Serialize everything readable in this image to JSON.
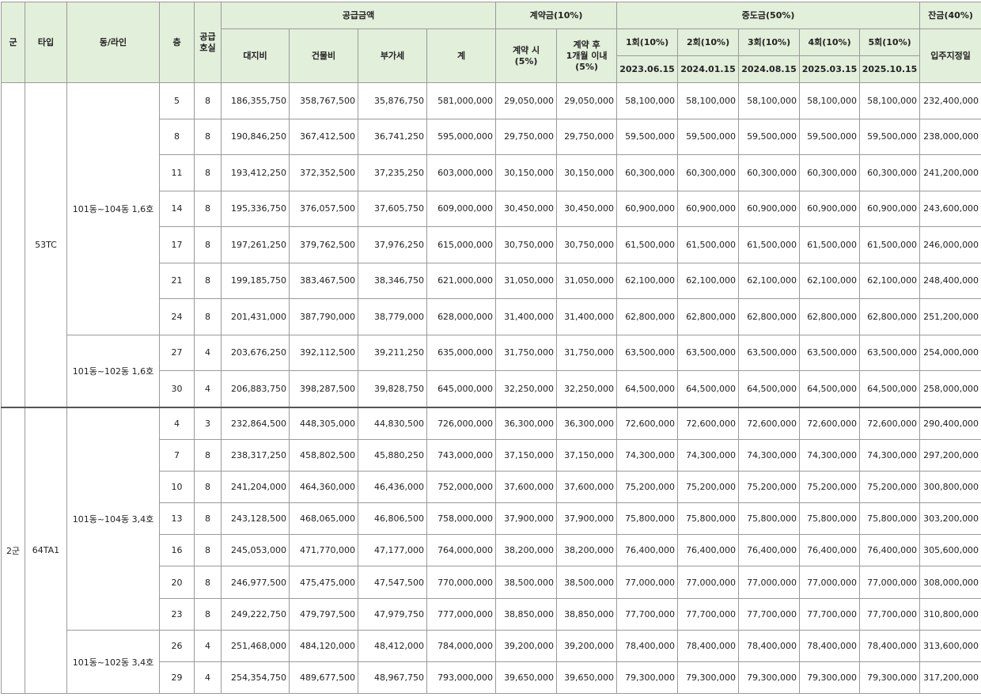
{
  "headers": {
    "gun": "군",
    "type": "타입",
    "dong_line": "동/라인",
    "floor": "층",
    "units_line1": "공급",
    "units_line2": "호실",
    "supply_amount": "공급금액",
    "land": "대지비",
    "building": "건물비",
    "vat": "부가세",
    "total": "계",
    "contract": "계약금(10%)",
    "contract_at_line1": "계약 시",
    "contract_at_line2": "(5%)",
    "contract_after_line1": "계약 후",
    "contract_after_line2": "1개월 이내",
    "contract_after_line3": "(5%)",
    "interim": "중도금(50%)",
    "interim_labels": [
      "1회(10%)",
      "2회(10%)",
      "3회(10%)",
      "4회(10%)",
      "5회(10%)"
    ],
    "interim_dates": [
      "2023.06.15",
      "2024.01.15",
      "2024.08.15",
      "2025.03.15",
      "2025.10.15"
    ],
    "balance": "잔금(40%)",
    "move_in": "입주지정일"
  },
  "groups": [
    {
      "gun": "",
      "type": "53TC",
      "blocks": [
        {
          "dong": "101동~104동 1,6호",
          "rows": [
            [
              "5",
              "8",
              "186,355,750",
              "358,767,500",
              "35,876,750",
              "581,000,000",
              "29,050,000",
              "29,050,000",
              "58,100,000",
              "58,100,000",
              "58,100,000",
              "58,100,000",
              "58,100,000",
              "232,400,000"
            ],
            [
              "8",
              "8",
              "190,846,250",
              "367,412,500",
              "36,741,250",
              "595,000,000",
              "29,750,000",
              "29,750,000",
              "59,500,000",
              "59,500,000",
              "59,500,000",
              "59,500,000",
              "59,500,000",
              "238,000,000"
            ],
            [
              "11",
              "8",
              "193,412,250",
              "372,352,500",
              "37,235,250",
              "603,000,000",
              "30,150,000",
              "30,150,000",
              "60,300,000",
              "60,300,000",
              "60,300,000",
              "60,300,000",
              "60,300,000",
              "241,200,000"
            ],
            [
              "14",
              "8",
              "195,336,750",
              "376,057,500",
              "37,605,750",
              "609,000,000",
              "30,450,000",
              "30,450,000",
              "60,900,000",
              "60,900,000",
              "60,900,000",
              "60,900,000",
              "60,900,000",
              "243,600,000"
            ],
            [
              "17",
              "8",
              "197,261,250",
              "379,762,500",
              "37,976,250",
              "615,000,000",
              "30,750,000",
              "30,750,000",
              "61,500,000",
              "61,500,000",
              "61,500,000",
              "61,500,000",
              "61,500,000",
              "246,000,000"
            ],
            [
              "21",
              "8",
              "199,185,750",
              "383,467,500",
              "38,346,750",
              "621,000,000",
              "31,050,000",
              "31,050,000",
              "62,100,000",
              "62,100,000",
              "62,100,000",
              "62,100,000",
              "62,100,000",
              "248,400,000"
            ],
            [
              "24",
              "8",
              "201,431,000",
              "387,790,000",
              "38,779,000",
              "628,000,000",
              "31,400,000",
              "31,400,000",
              "62,800,000",
              "62,800,000",
              "62,800,000",
              "62,800,000",
              "62,800,000",
              "251,200,000"
            ]
          ]
        },
        {
          "dong": "101동~102동 1,6호",
          "rows": [
            [
              "27",
              "4",
              "203,676,250",
              "392,112,500",
              "39,211,250",
              "635,000,000",
              "31,750,000",
              "31,750,000",
              "63,500,000",
              "63,500,000",
              "63,500,000",
              "63,500,000",
              "63,500,000",
              "254,000,000"
            ],
            [
              "30",
              "4",
              "206,883,750",
              "398,287,500",
              "39,828,750",
              "645,000,000",
              "32,250,000",
              "32,250,000",
              "64,500,000",
              "64,500,000",
              "64,500,000",
              "64,500,000",
              "64,500,000",
              "258,000,000"
            ]
          ]
        }
      ]
    },
    {
      "gun": "2군",
      "type": "64TA1",
      "blocks": [
        {
          "dong": "101동~104동 3,4호",
          "rows": [
            [
              "4",
              "3",
              "232,864,500",
              "448,305,000",
              "44,830,500",
              "726,000,000",
              "36,300,000",
              "36,300,000",
              "72,600,000",
              "72,600,000",
              "72,600,000",
              "72,600,000",
              "72,600,000",
              "290,400,000"
            ],
            [
              "7",
              "8",
              "238,317,250",
              "458,802,500",
              "45,880,250",
              "743,000,000",
              "37,150,000",
              "37,150,000",
              "74,300,000",
              "74,300,000",
              "74,300,000",
              "74,300,000",
              "74,300,000",
              "297,200,000"
            ],
            [
              "10",
              "8",
              "241,204,000",
              "464,360,000",
              "46,436,000",
              "752,000,000",
              "37,600,000",
              "37,600,000",
              "75,200,000",
              "75,200,000",
              "75,200,000",
              "75,200,000",
              "75,200,000",
              "300,800,000"
            ],
            [
              "13",
              "8",
              "243,128,500",
              "468,065,000",
              "46,806,500",
              "758,000,000",
              "37,900,000",
              "37,900,000",
              "75,800,000",
              "75,800,000",
              "75,800,000",
              "75,800,000",
              "75,800,000",
              "303,200,000"
            ],
            [
              "16",
              "8",
              "245,053,000",
              "471,770,000",
              "47,177,000",
              "764,000,000",
              "38,200,000",
              "38,200,000",
              "76,400,000",
              "76,400,000",
              "76,400,000",
              "76,400,000",
              "76,400,000",
              "305,600,000"
            ],
            [
              "20",
              "8",
              "246,977,500",
              "475,475,000",
              "47,547,500",
              "770,000,000",
              "38,500,000",
              "38,500,000",
              "77,000,000",
              "77,000,000",
              "77,000,000",
              "77,000,000",
              "77,000,000",
              "308,000,000"
            ],
            [
              "23",
              "8",
              "249,222,750",
              "479,797,500",
              "47,979,750",
              "777,000,000",
              "38,850,000",
              "38,850,000",
              "77,700,000",
              "77,700,000",
              "77,700,000",
              "77,700,000",
              "77,700,000",
              "310,800,000"
            ]
          ]
        },
        {
          "dong": "101동~102동 3,4호",
          "rows": [
            [
              "26",
              "4",
              "251,468,000",
              "484,120,000",
              "48,412,000",
              "784,000,000",
              "39,200,000",
              "39,200,000",
              "78,400,000",
              "78,400,000",
              "78,400,000",
              "78,400,000",
              "78,400,000",
              "313,600,000"
            ],
            [
              "29",
              "4",
              "254,354,750",
              "489,677,500",
              "48,967,750",
              "793,000,000",
              "39,650,000",
              "39,650,000",
              "79,300,000",
              "79,300,000",
              "79,300,000",
              "79,300,000",
              "79,300,000",
              "317,200,000"
            ]
          ]
        }
      ]
    }
  ]
}
